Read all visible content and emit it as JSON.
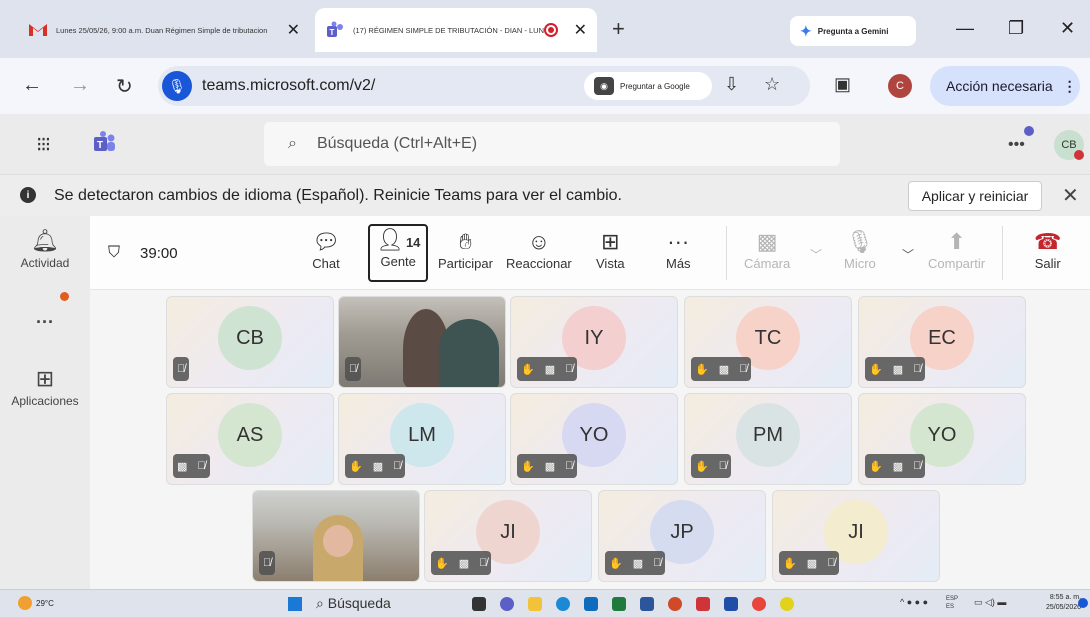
{
  "browser": {
    "tabs": [
      {
        "title": "Lunes 25/05/26, 9:00 a.m. Duan Régimen Simple de tributacion",
        "icon": "gmail-icon"
      },
      {
        "title": "(17) RÉGIMEN SIMPLE DE TRIBUTACIÓN - DIAN - LUNES",
        "icon": "teams-icon"
      }
    ],
    "gemini_label": "Pregunta a Gemini",
    "url": "teams.microsoft.com/v2/",
    "google_button": "Preguntar a Google",
    "profile_initial": "C",
    "action_label": "Acción necesaria"
  },
  "teams": {
    "search_placeholder": "Búsqueda (Ctrl+Alt+E)",
    "user_initials": "CB",
    "notice": {
      "message": "Se detectaron cambios de idioma (Español). Reinicie Teams para ver el cambio.",
      "apply_label": "Aplicar y reiniciar"
    },
    "rail": {
      "activity": "Actividad",
      "apps": "Aplicaciones"
    },
    "meeting": {
      "timer": "39:00",
      "people_count": "14",
      "buttons": {
        "chat": "Chat",
        "people": "Gente",
        "raise": "Participar",
        "react": "Reaccionar",
        "view": "Vista",
        "more": "Más",
        "camera": "Cámara",
        "mic": "Micro",
        "share": "Compartir",
        "leave": "Salir"
      },
      "participants": [
        {
          "initials": "CB",
          "color": "#cfe3d3"
        },
        {
          "initials": "",
          "color": ""
        },
        {
          "initials": "IY",
          "color": "#f4cfd0"
        },
        {
          "initials": "TC",
          "color": "#f6d2c8"
        },
        {
          "initials": "EC",
          "color": "#f6d2c8"
        },
        {
          "initials": "AS",
          "color": "#d4e6cf"
        },
        {
          "initials": "LM",
          "color": "#cde7ec"
        },
        {
          "initials": "YO",
          "color": "#d7d8f1"
        },
        {
          "initials": "PM",
          "color": "#d9e3e3"
        },
        {
          "initials": "YO",
          "color": "#d4e6cf"
        },
        {
          "initials": "",
          "color": ""
        },
        {
          "initials": "JI",
          "color": "#efd5cf"
        },
        {
          "initials": "JP",
          "color": "#d5dcef"
        },
        {
          "initials": "JI",
          "color": "#f3ecce"
        }
      ]
    }
  },
  "taskbar": {
    "weather": "29°C",
    "search": "Búsqueda",
    "lang": "ESP",
    "lang2": "ES",
    "time": "8:55 a. m.",
    "date": "25/05/2026"
  },
  "colors": {
    "teams_accent": "#5b5fc7",
    "leave_red": "#c4262e",
    "mic_blue": "#1a56d8"
  }
}
